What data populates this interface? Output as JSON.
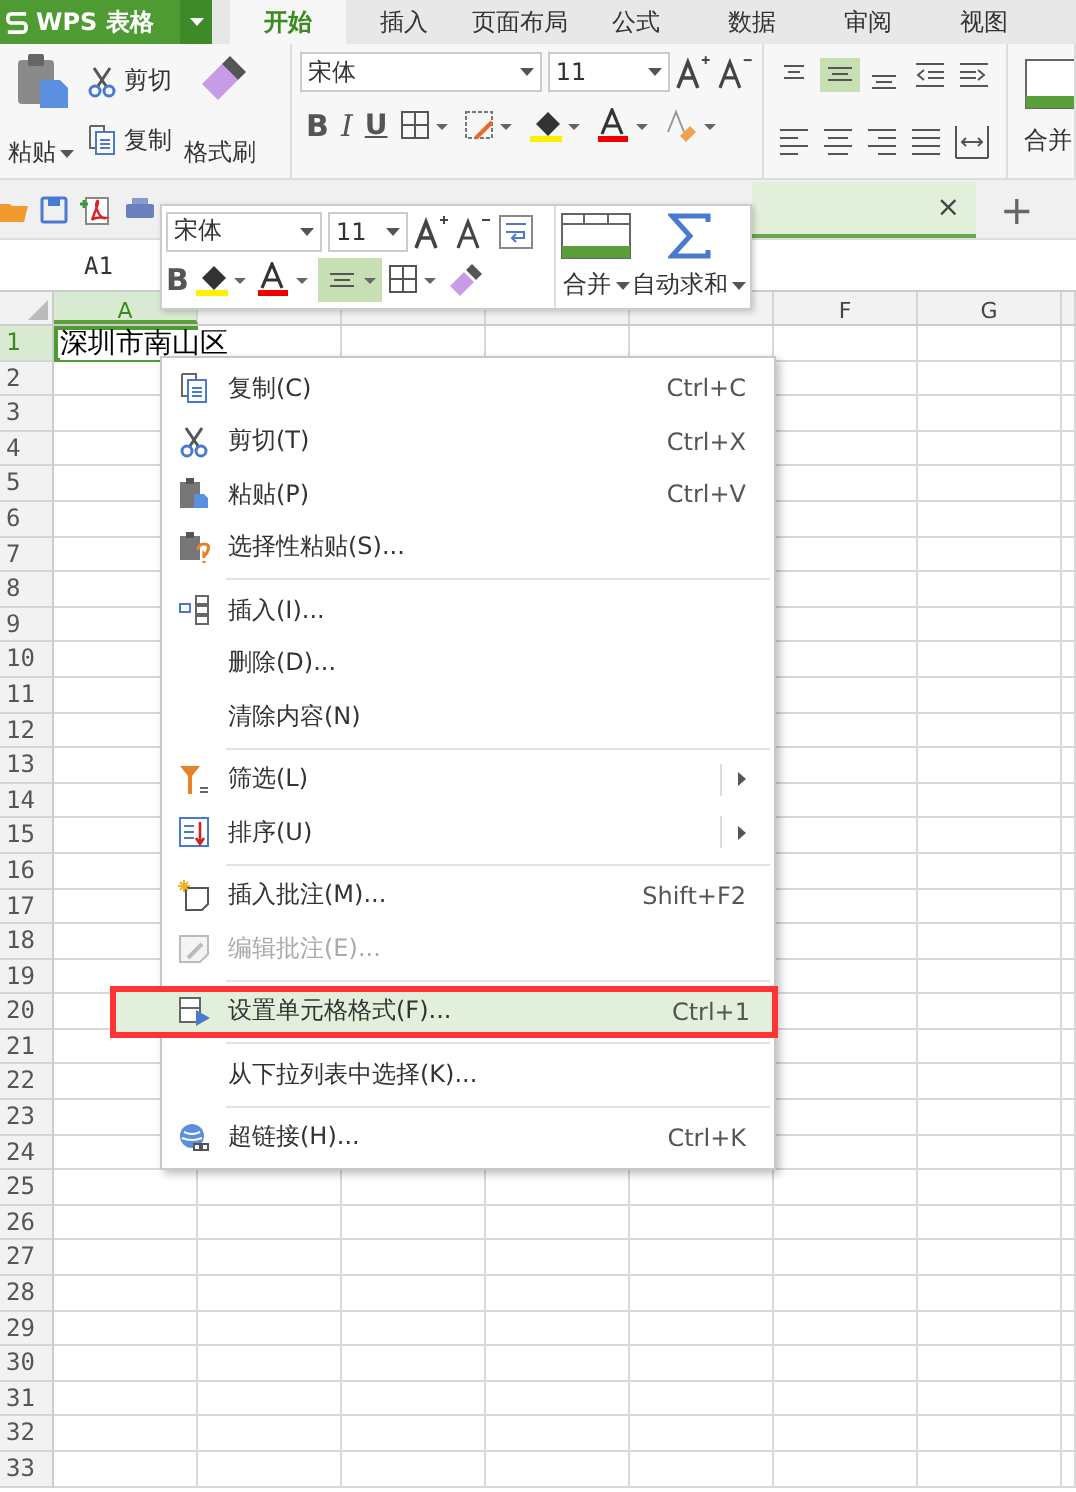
{
  "app": {
    "logo": "WPS 表格"
  },
  "ribbon_tabs": [
    {
      "label": "开始",
      "selected": true
    },
    {
      "label": "插入",
      "selected": false
    },
    {
      "label": "页面布局",
      "selected": false
    },
    {
      "label": "公式",
      "selected": false
    },
    {
      "label": "数据",
      "selected": false
    },
    {
      "label": "审阅",
      "selected": false
    },
    {
      "label": "视图",
      "selected": false
    }
  ],
  "ribbon": {
    "paste": "粘贴",
    "cut": "剪切",
    "copy": "复制",
    "format_painter": "格式刷",
    "font": "宋体",
    "font_size": "11",
    "bold": "B",
    "italic": "I",
    "underline": "U",
    "merge": "合并"
  },
  "document_tabs": {
    "close": "×",
    "new": "+"
  },
  "name_box": "A1",
  "columns": [
    {
      "label": "A",
      "selected": true
    },
    {
      "selected": false
    },
    {
      "selected": false
    },
    {
      "selected": false
    },
    {
      "selected": false
    },
    {
      "label": "F",
      "selected": false
    },
    {
      "label": "G",
      "selected": false
    }
  ],
  "rows": [
    {
      "label": "1",
      "selected": true,
      "value": "深圳市南山区"
    },
    {
      "label": "2",
      "selected": false
    },
    {
      "label": "3",
      "selected": false
    },
    {
      "label": "4",
      "selected": false
    },
    {
      "label": "5",
      "selected": false
    },
    {
      "label": "6",
      "selected": false
    },
    {
      "label": "7",
      "selected": false
    },
    {
      "label": "8",
      "selected": false
    },
    {
      "label": "9",
      "selected": false
    },
    {
      "label": "10",
      "selected": false
    },
    {
      "label": "11",
      "selected": false
    },
    {
      "label": "12",
      "selected": false
    },
    {
      "label": "13",
      "selected": false
    },
    {
      "label": "14",
      "selected": false
    },
    {
      "label": "15",
      "selected": false
    },
    {
      "label": "16",
      "selected": false
    },
    {
      "label": "17",
      "selected": false
    },
    {
      "label": "18",
      "selected": false
    },
    {
      "label": "19",
      "selected": false
    },
    {
      "label": "20",
      "selected": false
    },
    {
      "label": "21",
      "selected": false
    },
    {
      "label": "22",
      "selected": false
    },
    {
      "label": "23",
      "selected": false
    },
    {
      "label": "24",
      "selected": false
    },
    {
      "label": "25",
      "selected": false
    },
    {
      "label": "26",
      "selected": false
    },
    {
      "label": "27",
      "selected": false
    },
    {
      "label": "28",
      "selected": false
    },
    {
      "label": "29",
      "selected": false
    },
    {
      "label": "30",
      "selected": false
    },
    {
      "label": "31",
      "selected": false
    },
    {
      "label": "32",
      "selected": false
    },
    {
      "label": "33",
      "selected": false
    }
  ],
  "mini_toolbar": {
    "font": "宋体",
    "font_size": "11",
    "bold": "B",
    "merge": "合并",
    "autosum": "自动求和"
  },
  "context_menu": [
    [
      {
        "label": "复制(C)",
        "shortcut": "Ctrl+C",
        "submenu": false,
        "disabled": false,
        "selected": false,
        "annotated": false
      },
      {
        "label": "剪切(T)",
        "shortcut": "Ctrl+X",
        "submenu": false,
        "disabled": false,
        "selected": false,
        "annotated": false
      },
      {
        "label": "粘贴(P)",
        "shortcut": "Ctrl+V",
        "submenu": false,
        "disabled": false,
        "selected": false,
        "annotated": false
      },
      {
        "label": "选择性粘贴(S)...",
        "submenu": false,
        "disabled": false,
        "selected": false,
        "annotated": false
      }
    ],
    [
      {
        "label": "插入(I)...",
        "submenu": false,
        "disabled": false,
        "selected": false,
        "annotated": false
      },
      {
        "label": "删除(D)...",
        "submenu": false,
        "disabled": false,
        "selected": false,
        "annotated": false
      },
      {
        "label": "清除内容(N)",
        "submenu": false,
        "disabled": false,
        "selected": false,
        "annotated": false
      }
    ],
    [
      {
        "label": "筛选(L)",
        "submenu": true,
        "disabled": false,
        "selected": false,
        "annotated": false
      },
      {
        "label": "排序(U)",
        "submenu": true,
        "disabled": false,
        "selected": false,
        "annotated": false
      }
    ],
    [
      {
        "label": "插入批注(M)...",
        "shortcut": "Shift+F2",
        "submenu": false,
        "disabled": false,
        "selected": false,
        "annotated": false
      },
      {
        "label": "编辑批注(E)...",
        "submenu": false,
        "disabled": true,
        "selected": false,
        "annotated": false
      }
    ],
    [
      {
        "label": "设置单元格格式(F)...",
        "shortcut": "Ctrl+1",
        "submenu": false,
        "disabled": false,
        "selected": true,
        "annotated": true
      }
    ],
    [
      {
        "label": "从下拉列表中选择(K)...",
        "submenu": false,
        "disabled": false,
        "selected": false,
        "annotated": false
      }
    ],
    [
      {
        "label": "超链接(H)...",
        "shortcut": "Ctrl+K",
        "submenu": false,
        "disabled": false,
        "selected": false,
        "annotated": false
      }
    ]
  ]
}
